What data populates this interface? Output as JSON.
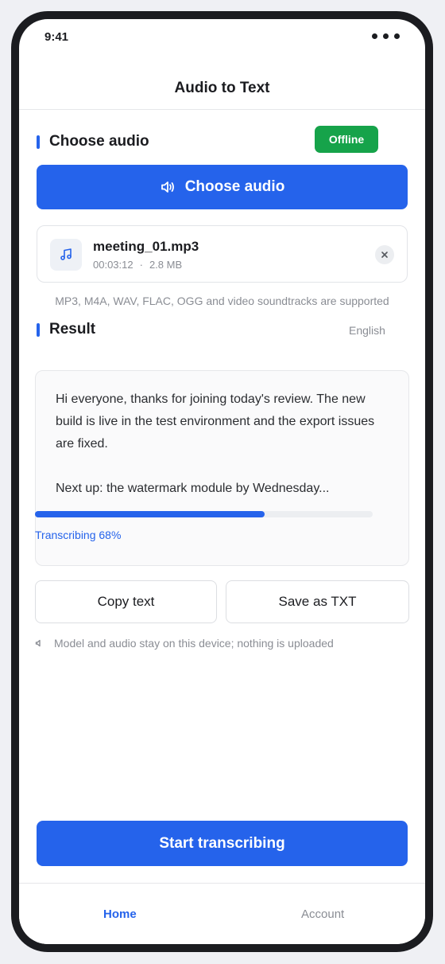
{
  "status_bar": {
    "time": "9:41"
  },
  "header": {
    "title": "Audio to Text"
  },
  "choose_section": {
    "title": "Choose audio",
    "badge": "Offline",
    "button_label": "Choose audio",
    "button_icon": "speaker-icon"
  },
  "file": {
    "icon": "music-note-icon",
    "name": "meeting_01.mp3",
    "duration": "00:03:12",
    "separator": "·",
    "size": "2.8 MB",
    "remove_icon": "close-icon"
  },
  "formats_note": "MP3, M4A, WAV, FLAC, OGG and video soundtracks are supported",
  "result_section": {
    "title": "Result",
    "language": "English",
    "paragraphs": [
      "Hi everyone, thanks for joining today's review. The new build is live in the test environment and the export issues are fixed.",
      "Next up: the watermark module by Wednesday..."
    ],
    "progress_percent": 68,
    "progress_label": "Transcribing 68%"
  },
  "actions": {
    "copy_label": "Copy text",
    "save_label": "Save as TXT"
  },
  "privacy_note": "Model and audio stay on this device; nothing is uploaded",
  "start_button": "Start transcribing",
  "tabs": [
    {
      "label": "Home",
      "active": true
    },
    {
      "label": "Account",
      "active": false
    }
  ],
  "colors": {
    "accent": "#2563eb",
    "badge": "#16a34a",
    "muted_text": "#8a8d94",
    "text": "#1b1c20"
  }
}
